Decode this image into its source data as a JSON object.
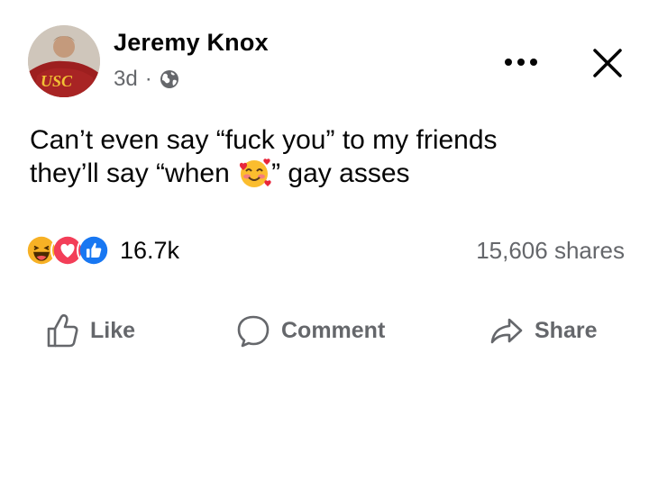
{
  "post": {
    "author": "Jeremy Knox",
    "time": "3d",
    "separator": "·",
    "audience_icon": "globe-icon",
    "avatar_shirt_text": "USC",
    "text_line1": "Can’t even say “fuck you” to my friends",
    "text_line2_before": "they’ll say “when ",
    "text_line2_after": "” gay asses",
    "inline_emoji": "smiling-face-with-hearts"
  },
  "reactions": {
    "types": [
      "haha",
      "love",
      "like"
    ],
    "count": "16.7k",
    "shares": "15,606 shares"
  },
  "actions": {
    "like_label": "Like",
    "comment_label": "Comment",
    "share_label": "Share"
  },
  "colors": {
    "text": "#050505",
    "secondary": "#65676b",
    "like_blue": "#1877f2",
    "love_red": "#f33e58",
    "haha_yellow": "#f7b125"
  }
}
